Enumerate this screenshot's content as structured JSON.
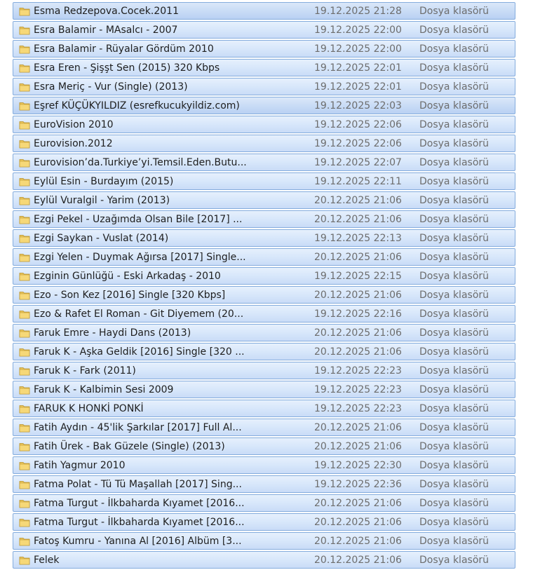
{
  "folder_icon": "folder-icon",
  "rows": [
    {
      "name": "Esma Redzepova.Cocek.2011",
      "date": "19.12.2025 21:28",
      "type": "Dosya klasörü"
    },
    {
      "name": "Esra Balamir - MAsalcı - 2007",
      "date": "19.12.2025 22:00",
      "type": "Dosya klasörü"
    },
    {
      "name": "Esra Balamir - Rüyalar Gördüm 2010",
      "date": "19.12.2025 22:00",
      "type": "Dosya klasörü"
    },
    {
      "name": "Esra Eren - Şişşt Sen (2015) 320 Kbps",
      "date": "19.12.2025 22:01",
      "type": "Dosya klasörü"
    },
    {
      "name": "Esra Meriç - Vur (Single) (2013)",
      "date": "19.12.2025 22:01",
      "type": "Dosya klasörü"
    },
    {
      "name": "Eşref KÜÇÜKYILDIZ (esrefkucukyildiz.com)",
      "date": "19.12.2025 22:03",
      "type": "Dosya klasörü"
    },
    {
      "name": "EuroVision 2010",
      "date": "19.12.2025 22:06",
      "type": "Dosya klasörü"
    },
    {
      "name": "Eurovision.2012",
      "date": "19.12.2025 22:06",
      "type": "Dosya klasörü"
    },
    {
      "name": "Eurovision’da.Turkiye’yi.Temsil.Eden.Butu...",
      "date": "19.12.2025 22:07",
      "type": "Dosya klasörü"
    },
    {
      "name": "Eylül Esin - Burdayım (2015)",
      "date": "19.12.2025 22:11",
      "type": "Dosya klasörü"
    },
    {
      "name": "Eylül Vuralgil - Yarim (2013)",
      "date": "20.12.2025 21:06",
      "type": "Dosya klasörü"
    },
    {
      "name": "Ezgi Pekel - Uzağımda Olsan Bile [2017] ...",
      "date": "20.12.2025 21:06",
      "type": "Dosya klasörü"
    },
    {
      "name": "Ezgi Saykan - Vuslat (2014)",
      "date": "19.12.2025 22:13",
      "type": "Dosya klasörü"
    },
    {
      "name": "Ezgi Yelen - Duymak Ağırsa [2017] Single...",
      "date": "20.12.2025 21:06",
      "type": "Dosya klasörü"
    },
    {
      "name": "Ezginin Günlüğü - Eski Arkadaş - 2010",
      "date": "19.12.2025 22:15",
      "type": "Dosya klasörü"
    },
    {
      "name": "Ezo - Son Kez [2016] Single [320 Kbps]",
      "date": "20.12.2025 21:06",
      "type": "Dosya klasörü"
    },
    {
      "name": "Ezo & Rafet El Roman - Git Diyemem (20...",
      "date": "19.12.2025 22:16",
      "type": "Dosya klasörü"
    },
    {
      "name": "Faruk Emre - Haydi Dans (2013)",
      "date": "20.12.2025 21:06",
      "type": "Dosya klasörü"
    },
    {
      "name": "Faruk K - Aşka Geldik [2016] Single [320 ...",
      "date": "20.12.2025 21:06",
      "type": "Dosya klasörü"
    },
    {
      "name": "Faruk K - Fark (2011)",
      "date": "19.12.2025 22:23",
      "type": "Dosya klasörü"
    },
    {
      "name": "Faruk K - Kalbimin Sesi 2009",
      "date": "19.12.2025 22:23",
      "type": "Dosya klasörü"
    },
    {
      "name": "FARUK K HONKİ PONKİ",
      "date": "19.12.2025 22:23",
      "type": "Dosya klasörü"
    },
    {
      "name": "Fatih Aydın - 45'lik Şarkılar [2017] Full Al...",
      "date": "20.12.2025 21:06",
      "type": "Dosya klasörü"
    },
    {
      "name": "Fatih Ürek - Bak Güzele (Single) (2013)",
      "date": "20.12.2025 21:06",
      "type": "Dosya klasörü"
    },
    {
      "name": "Fatih Yagmur  2010",
      "date": "19.12.2025 22:30",
      "type": "Dosya klasörü"
    },
    {
      "name": "Fatma Polat - Tü Tü Maşallah [2017] Sing...",
      "date": "19.12.2025 22:36",
      "type": "Dosya klasörü"
    },
    {
      "name": "Fatma Turgut - İlkbaharda Kıyamet [2016...",
      "date": "20.12.2025 21:06",
      "type": "Dosya klasörü"
    },
    {
      "name": "Fatma Turgut - İlkbaharda Kıyamet [2016...",
      "date": "20.12.2025 21:06",
      "type": "Dosya klasörü"
    },
    {
      "name": "Fatoş Kumru - Yanına Al [2016] Albüm [3...",
      "date": "20.12.2025 21:06",
      "type": "Dosya klasörü"
    },
    {
      "name": "Felek",
      "date": "20.12.2025 21:06",
      "type": "Dosya klasörü"
    }
  ]
}
